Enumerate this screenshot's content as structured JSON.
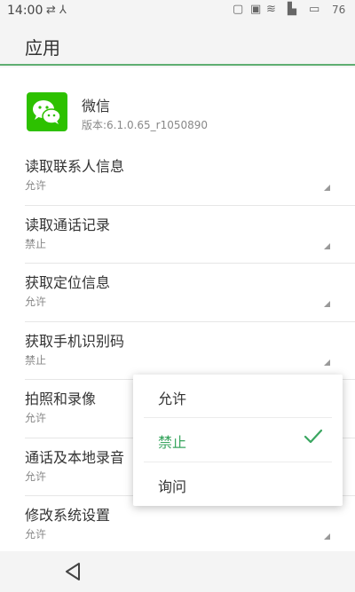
{
  "status_bar": {
    "time": "14:00",
    "battery": "76"
  },
  "app_bar": {
    "title": "应用"
  },
  "app_info": {
    "name": "微信",
    "version": "版本:6.1.0.65_r1050890"
  },
  "permissions": [
    {
      "label": "读取联系人信息",
      "value": "允许"
    },
    {
      "label": "读取通话记录",
      "value": "禁止"
    },
    {
      "label": "获取定位信息",
      "value": "允许"
    },
    {
      "label": "获取手机识别码",
      "value": "禁止"
    },
    {
      "label": "拍照和录像",
      "value": "允许"
    },
    {
      "label": "通话及本地录音",
      "value": "允许"
    },
    {
      "label": "修改系统设置",
      "value": "允许"
    }
  ],
  "popup_menu": {
    "options": [
      {
        "label": "允许",
        "selected": false
      },
      {
        "label": "禁止",
        "selected": true
      },
      {
        "label": "询问",
        "selected": false
      }
    ]
  },
  "colors": {
    "accent": "#3aa660",
    "wechat_green": "#2dc100"
  },
  "icons": {
    "usb": "usb-icon",
    "signal": "signal-icon",
    "wifi": "wifi-icon",
    "check": "check-icon",
    "back": "back-icon",
    "wechat": "wechat-icon"
  }
}
